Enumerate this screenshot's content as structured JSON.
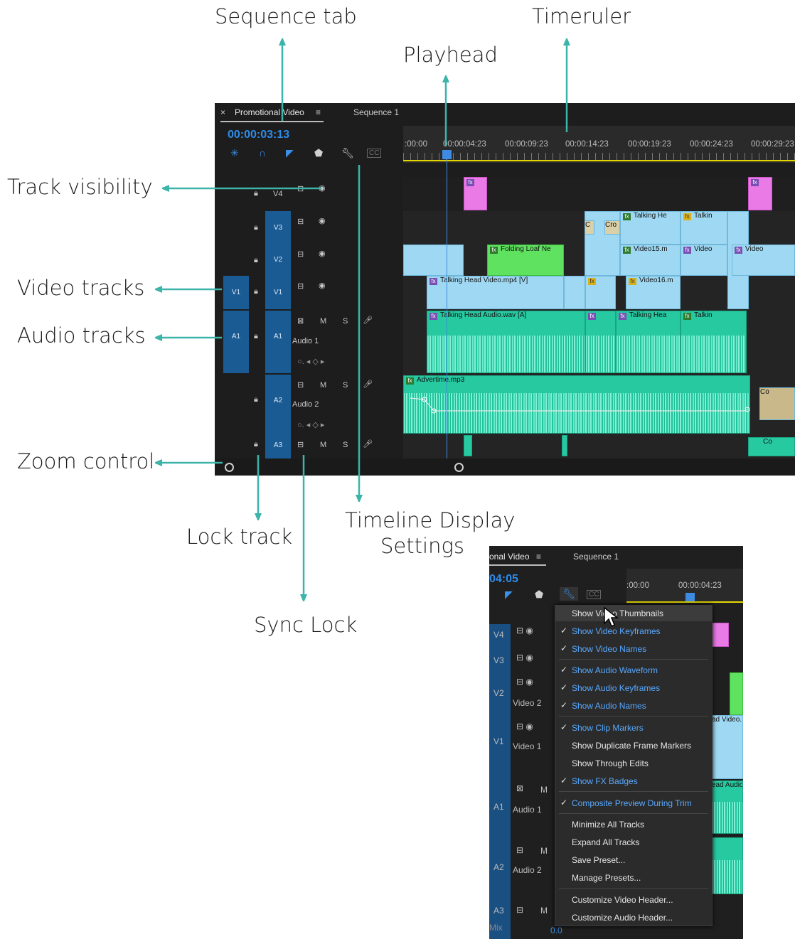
{
  "callouts": {
    "sequence_tab": "Sequence tab",
    "timeruler": "Timeruler",
    "playhead": "Playhead",
    "track_visibility": "Track visibility",
    "video_tracks": "Video tracks",
    "audio_tracks": "Audio tracks",
    "zoom_control": "Zoom control",
    "lock_track": "Lock track",
    "timeline_display_settings_line1": "Timeline Display",
    "timeline_display_settings_line2": "Settings",
    "sync_lock": "Sync Lock"
  },
  "timeline": {
    "close_symbol": "×",
    "tab_active": "Promotional Video",
    "tab_menu_symbol": "≡",
    "tab_other": "Sequence 1",
    "timecode": "00:00:03:13",
    "ruler_ticks": [
      ":00:00",
      "00:00:04:23",
      "00:00:09:23",
      "00:00:14:23",
      "00:00:19:23",
      "00:00:24:23",
      "00:00:29:23"
    ],
    "tracks": {
      "v4": "V4",
      "v3": "V3",
      "v2": "V2",
      "v1": "V1",
      "a1": "A1",
      "a2": "A2",
      "a3": "A3",
      "audio1_name": "Audio 1",
      "audio2_name": "Audio 2",
      "mute": "M",
      "solo": "S"
    },
    "clips": {
      "talking_head_video": "Talking Head Video.mp4 [V]",
      "video16": "Video16.m",
      "video15": "Video15.m",
      "video": "Video",
      "folding_loaf": "Folding Loaf Ne",
      "talking_he": "Talking He",
      "talkin": "Talkin",
      "talking_head_audio": "Talking Head Audio.wav [A]",
      "talking_hea": "Talking Hea",
      "advertime": "Advertime.mp3",
      "cro": "Cro",
      "c": "C",
      "co": "Co",
      "r": "R",
      "l": "L"
    }
  },
  "menu_shot": {
    "tab_active": "onal Video",
    "tab_menu_symbol": "≡",
    "tab_other": "Sequence 1",
    "timecode": "04:05",
    "ruler_ticks": [
      ":00:00",
      "00:00:04:23"
    ],
    "side_labels": {
      "v4": "V4",
      "v3": "V3",
      "v2": "V2",
      "v1": "V1",
      "a1": "A1",
      "a2": "A2",
      "a3": "A3",
      "video2": "Video 2",
      "video1": "Video 1",
      "audio1": "Audio 1",
      "audio2": "Audio 2",
      "mix": "Mix",
      "mix_value": "0.0",
      "mute": "M"
    },
    "right_clips": {
      "ad_video": "ad Video.",
      "ead_audio": "ead Audio."
    },
    "checkmark": "✓",
    "menu_items": [
      {
        "label": "Show Video Thumbnails",
        "checked": false
      },
      {
        "label": "Show Video Keyframes",
        "checked": true
      },
      {
        "label": "Show Video Names",
        "checked": true
      },
      {
        "label": "Show Audio Waveform",
        "checked": true
      },
      {
        "label": "Show Audio Keyframes",
        "checked": true
      },
      {
        "label": "Show Audio Names",
        "checked": true
      },
      {
        "label": "Show Clip Markers",
        "checked": true
      },
      {
        "label": "Show Duplicate Frame Markers",
        "checked": false
      },
      {
        "label": "Show Through Edits",
        "checked": false
      },
      {
        "label": "Show FX Badges",
        "checked": true
      },
      {
        "label": "Composite Preview During Trim",
        "checked": true
      },
      {
        "label": "Minimize All Tracks",
        "checked": false
      },
      {
        "label": "Expand All Tracks",
        "checked": false
      },
      {
        "label": "Save Preset...",
        "checked": false
      },
      {
        "label": "Manage Presets...",
        "checked": false
      },
      {
        "label": "Customize Video Header...",
        "checked": false
      },
      {
        "label": "Customize Audio Header...",
        "checked": false
      }
    ]
  },
  "colors": {
    "arrow": "#3cb4aa",
    "timecode": "#2d8ceb",
    "video_clip": "#9fd8f2",
    "audio_clip": "#27c9a1",
    "menu_checked": "#58a9ff"
  }
}
